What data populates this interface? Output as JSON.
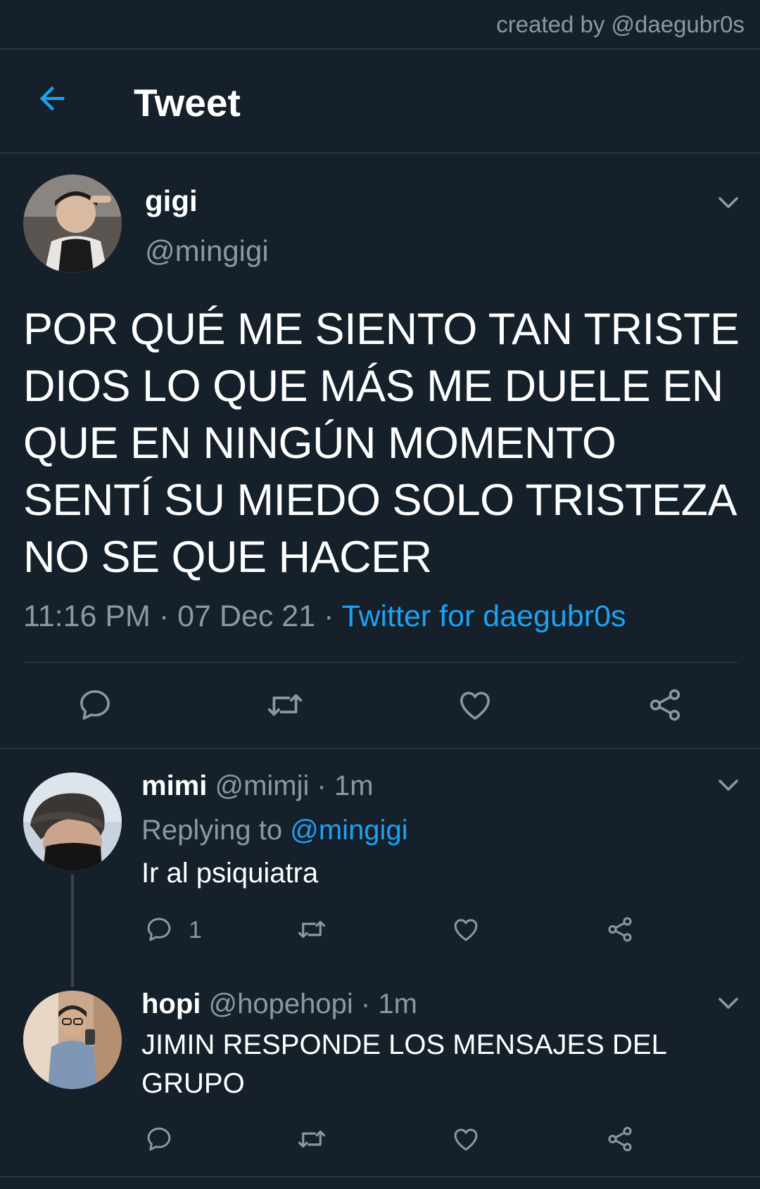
{
  "credit": "created by @daegubr0s",
  "header": {
    "title": "Tweet",
    "back_icon": "arrow-left-icon"
  },
  "main_tweet": {
    "name": "gigi",
    "handle": "@mingigi",
    "text": "POR QUÉ ME SIENTO TAN TRISTE DIOS LO QUE MÁS ME DUELE EN QUE EN NINGÚN MOMENTO SENTÍ SU MIEDO SOLO TRISTEZA NO SE QUE HACER",
    "time": "11:16 PM",
    "date": "07 Dec 21",
    "sep": "·",
    "source": "Twitter for daegubr0s",
    "actions": [
      "reply-icon",
      "retweet-icon",
      "like-icon",
      "share-icon"
    ]
  },
  "replies": [
    {
      "name": "mimi",
      "handle": "@mimji",
      "time": "· 1m",
      "replying_prefix": "Replying to",
      "replying_to": "@mingigi",
      "text": "Ir al psiquiatra",
      "reply_count": "1"
    },
    {
      "name": "hopi",
      "handle": "@hopehopi",
      "time": "· 1m",
      "text": "JIMIN RESPONDE LOS MENSAJES DEL GRUPO"
    }
  ],
  "colors": {
    "background": "#15202b",
    "accent": "#1da1f2",
    "muted": "#8899a6",
    "divider": "#38444d"
  }
}
